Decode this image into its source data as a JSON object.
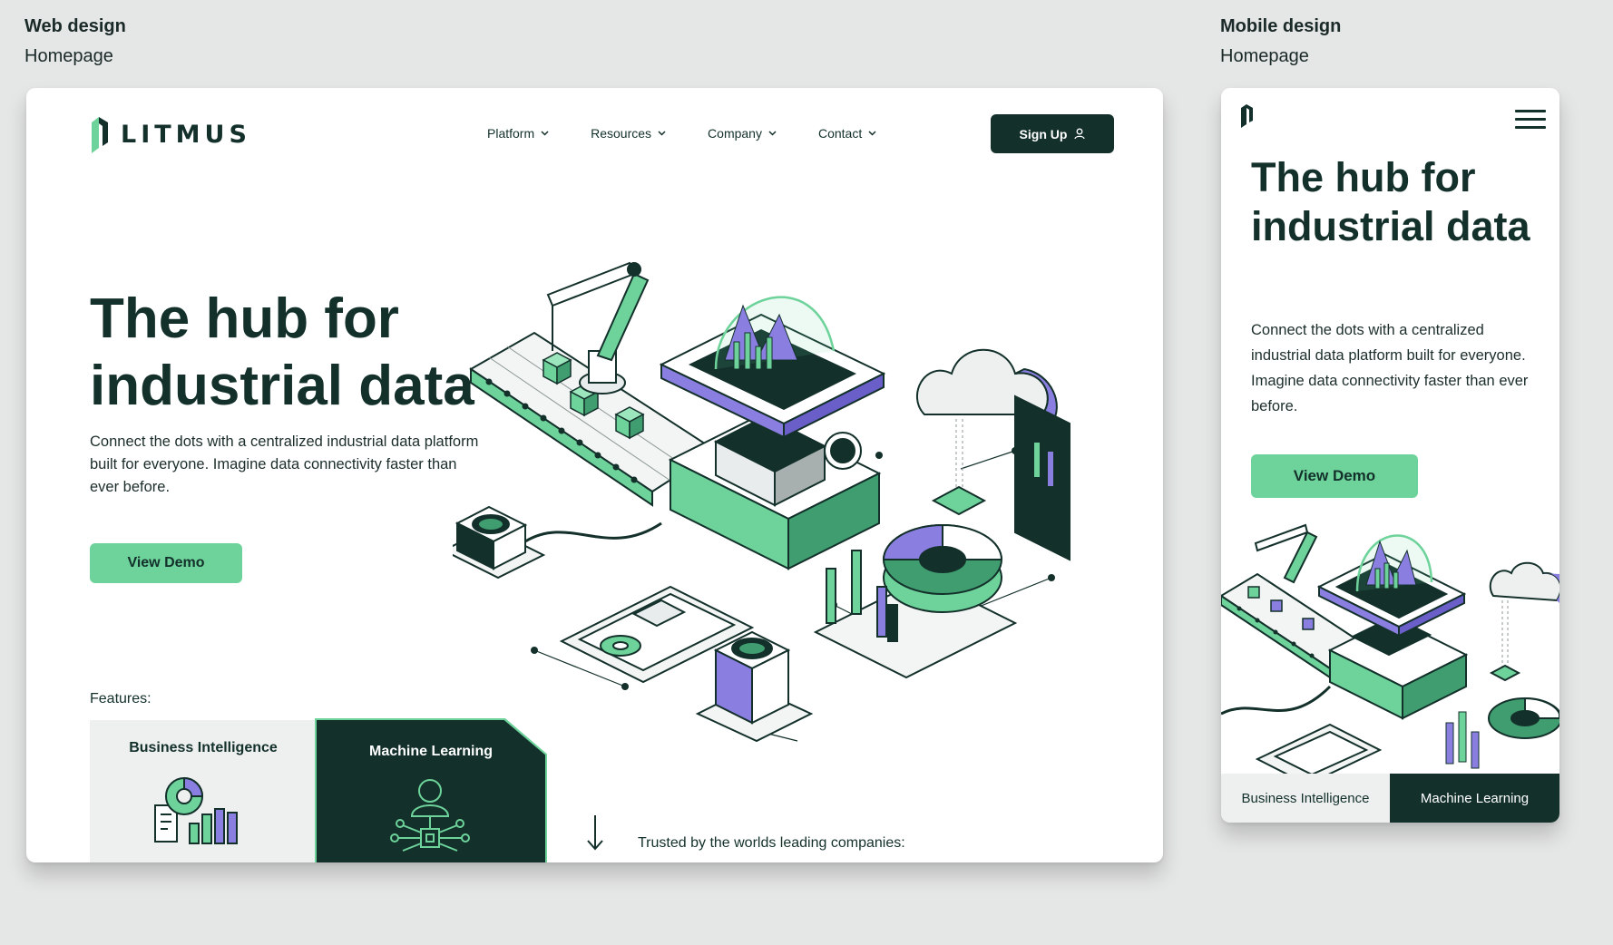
{
  "captions": {
    "web_title": "Web design",
    "web_sub": "Homepage",
    "mobile_title": "Mobile design",
    "mobile_sub": "Homepage"
  },
  "colors": {
    "dark": "#13302b",
    "accent_green": "#6dd39a",
    "purple": "#8a7fe0",
    "canvas": "#e5e6e6"
  },
  "web": {
    "logo_text": "LITMUS",
    "nav": [
      {
        "label": "Platform",
        "icon": "chevron-down-icon"
      },
      {
        "label": "Resources",
        "icon": "chevron-down-icon"
      },
      {
        "label": "Company",
        "icon": "chevron-down-icon"
      },
      {
        "label": "Contact",
        "icon": "chevron-down-icon"
      }
    ],
    "signup_label": "Sign Up",
    "hero_title_line1": "The hub for",
    "hero_title_line2": "industrial data",
    "hero_desc": "Connect the dots with a centralized industrial data platform built for everyone.  Imagine data connectivity faster than ever before.",
    "demo_label": "View Demo",
    "features_label": "Features:",
    "features": [
      {
        "label": "Business Intelligence",
        "icon": "chart-icon"
      },
      {
        "label": "Machine Learning",
        "icon": "ai-person-icon"
      }
    ],
    "trusted_label": "Trusted by the worlds leading companies:"
  },
  "mobile": {
    "title": "The hub for industrial data",
    "desc": "Connect the dots with a centralized industrial data platform built for everyone.  Imagine data connectivity faster than ever before.",
    "demo_label": "View Demo",
    "tabs": [
      "Business Intelligence",
      "Machine Learning"
    ]
  }
}
